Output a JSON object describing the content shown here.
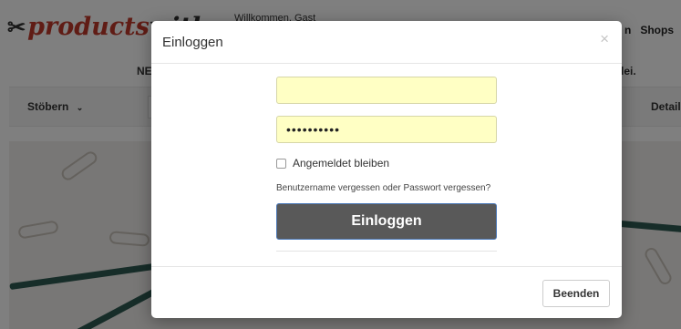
{
  "background": {
    "logo": {
      "prefix": "products",
      "suffix": "with"
    },
    "welcome_text": "Willkommen, Gast",
    "header_links": [
      "n",
      "Shops"
    ],
    "announcement_left": "NE",
    "announcement_right": "lei.",
    "nav": {
      "browse_label": "Stöbern",
      "detail_label": "Detail"
    }
  },
  "modal": {
    "title": "Einloggen",
    "close_symbol": "×",
    "username": {
      "value": ""
    },
    "password": {
      "value": "••••••••••"
    },
    "remember_label": "Angemeldet bleiben",
    "forgot_text": "Benutzername vergessen oder Passwort vergessen?",
    "login_button_label": "Einloggen",
    "footer_close_label": "Beenden"
  },
  "colors": {
    "overlay": "#000000",
    "field_bg": "#ffffc4",
    "login_button": "#595959",
    "login_button_border": "#4a78b8"
  }
}
